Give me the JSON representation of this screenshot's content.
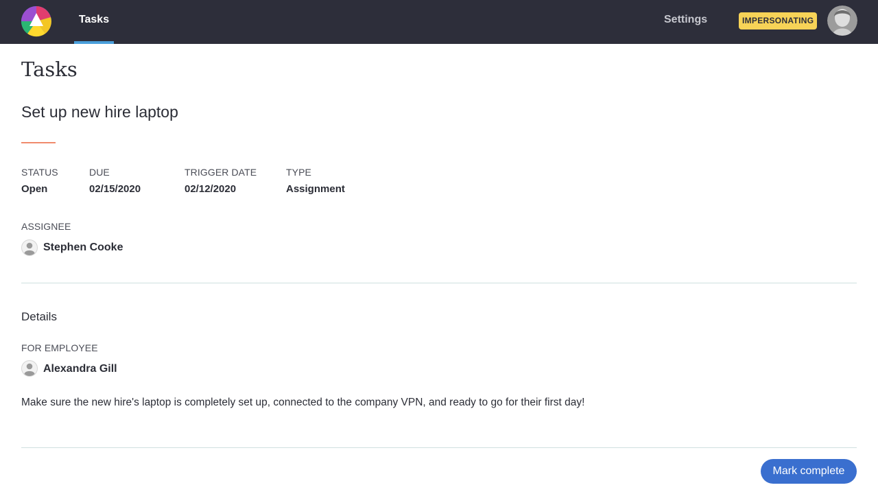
{
  "nav": {
    "logo_icon": "multicolor-logo-icon",
    "tab_label": "Tasks",
    "settings_label": "Settings",
    "badge_label": "IMPERSONATING",
    "accent_color": "#4a9fdb",
    "badge_color": "#f7d357"
  },
  "page": {
    "title": "Tasks"
  },
  "task": {
    "title": "Set up new hire laptop",
    "fields": [
      {
        "label": "STATUS",
        "value": "Open"
      },
      {
        "label": "DUE",
        "value": "02/15/2020"
      },
      {
        "label": "TRIGGER DATE",
        "value": "02/12/2020"
      },
      {
        "label": "TYPE",
        "value": "Assignment"
      }
    ],
    "assignee_label": "ASSIGNEE",
    "assignee_name": "Stephen Cooke"
  },
  "details": {
    "section_title": "Details",
    "employee_label": "FOR EMPLOYEE",
    "employee_name": "Alexandra Gill",
    "description": "Make sure the new hire's laptop is completely set up, connected to the company VPN, and ready to go for their first day!"
  },
  "actions": {
    "mark_complete_label": "Mark complete",
    "button_color": "#3a6fcf"
  }
}
